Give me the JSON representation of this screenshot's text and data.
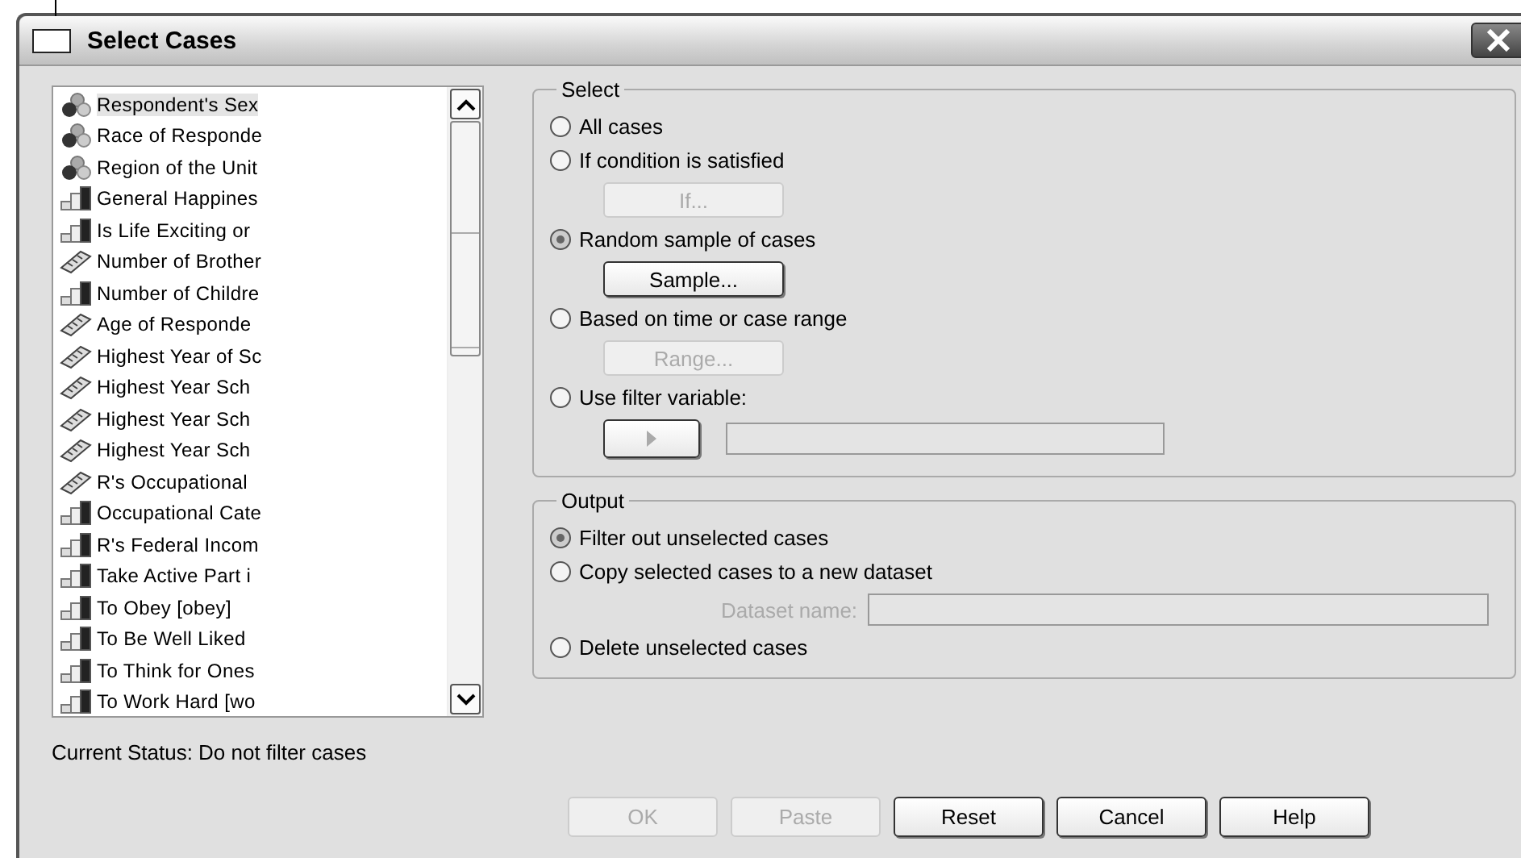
{
  "window": {
    "title": "Select Cases"
  },
  "variables": [
    {
      "label": "Respondent's Sex",
      "kind": "nominal",
      "selected": true
    },
    {
      "label": "Race of Responde",
      "kind": "nominal",
      "selected": false
    },
    {
      "label": "Region of the Unit",
      "kind": "nominal",
      "selected": false
    },
    {
      "label": "General Happines",
      "kind": "ordinal",
      "selected": false
    },
    {
      "label": "Is Life Exciting or",
      "kind": "ordinal",
      "selected": false
    },
    {
      "label": "Number of Brother",
      "kind": "scale",
      "selected": false
    },
    {
      "label": "Number of Childre",
      "kind": "ordinal",
      "selected": false
    },
    {
      "label": "Age of Responde",
      "kind": "scale",
      "selected": false
    },
    {
      "label": "Highest Year of Sc",
      "kind": "scale",
      "selected": false
    },
    {
      "label": "Highest Year Sch",
      "kind": "scale",
      "selected": false
    },
    {
      "label": "Highest Year Sch",
      "kind": "scale",
      "selected": false
    },
    {
      "label": "Highest Year Sch",
      "kind": "scale",
      "selected": false
    },
    {
      "label": "R's Occupational",
      "kind": "scale",
      "selected": false
    },
    {
      "label": "Occupational Cate",
      "kind": "ordinal",
      "selected": false
    },
    {
      "label": "R's Federal Incom",
      "kind": "ordinal",
      "selected": false
    },
    {
      "label": "Take Active Part i",
      "kind": "ordinal",
      "selected": false
    },
    {
      "label": "To Obey [obey]",
      "kind": "ordinal",
      "selected": false
    },
    {
      "label": "To Be Well Liked",
      "kind": "ordinal",
      "selected": false
    },
    {
      "label": "To Think for Ones",
      "kind": "ordinal",
      "selected": false
    },
    {
      "label": "To Work Hard [wo",
      "kind": "ordinal",
      "selected": false
    }
  ],
  "select_group": {
    "title": "Select",
    "options": [
      {
        "label": "All cases",
        "selected": false
      },
      {
        "label": "If condition is satisfied",
        "selected": false,
        "control": {
          "kind": "button",
          "label": "If...",
          "disabled": true
        }
      },
      {
        "label": "Random sample of cases",
        "selected": true,
        "control": {
          "kind": "button",
          "label": "Sample...",
          "disabled": false
        }
      },
      {
        "label": "Based on time or case range",
        "selected": false,
        "control": {
          "kind": "button",
          "label": "Range...",
          "disabled": true
        }
      },
      {
        "label": "Use filter variable:",
        "selected": false,
        "control": {
          "kind": "filter"
        }
      }
    ]
  },
  "output_group": {
    "title": "Output",
    "options": [
      {
        "label": "Filter out unselected cases",
        "selected": true
      },
      {
        "label": "Copy selected cases to a new dataset",
        "selected": false,
        "field": {
          "label": "Dataset name:",
          "disabled": true
        }
      },
      {
        "label": "Delete unselected cases",
        "selected": false
      }
    ]
  },
  "status": "Current Status: Do not filter cases",
  "buttons": [
    {
      "label": "OK",
      "disabled": true
    },
    {
      "label": "Paste",
      "disabled": true
    },
    {
      "label": "Reset",
      "disabled": false
    },
    {
      "label": "Cancel",
      "disabled": false
    },
    {
      "label": "Help",
      "disabled": false
    }
  ]
}
